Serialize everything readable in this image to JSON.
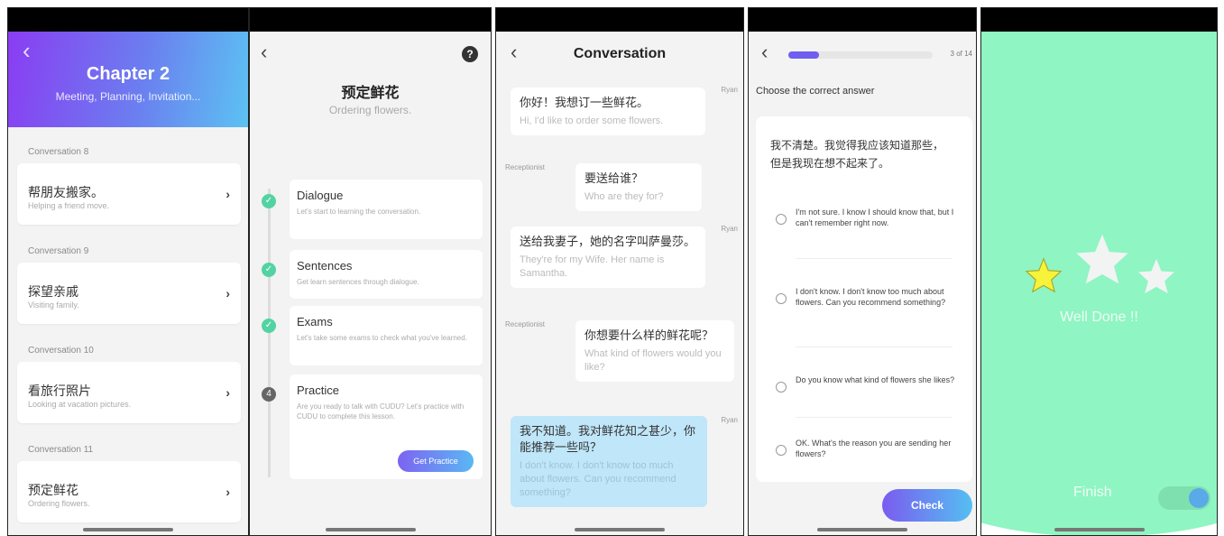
{
  "screen1": {
    "title": "Chapter 2",
    "subtitle": "Meeting, Planning, Invitation...",
    "items": [
      {
        "section": "Conversation 8",
        "zh": "帮朋友搬家。",
        "en": "Helping a friend move."
      },
      {
        "section": "Conversation 9",
        "zh": "探望亲戚",
        "en": "Visiting family."
      },
      {
        "section": "Conversation 10",
        "zh": "看旅行照片",
        "en": "Looking at vacation pictures."
      },
      {
        "section": "Conversation 11",
        "zh": "预定鲜花",
        "en": "Ordering flowers."
      }
    ]
  },
  "screen2": {
    "title_zh": "预定鲜花",
    "title_en": "Ordering flowers.",
    "steps": [
      {
        "title": "Dialogue",
        "desc": "Let's start to learning the conversation.",
        "status": "done"
      },
      {
        "title": "Sentences",
        "desc": "Get learn sentences through dialogue.",
        "status": "done"
      },
      {
        "title": "Exams",
        "desc": "Let's take some exams to check what you've learned.",
        "status": "done"
      },
      {
        "title": "Practice",
        "desc": "Are you ready to talk with CUDU? Let's practice with CUDU to complete this lesson.",
        "status": "4"
      }
    ],
    "practice_button": "Get Practice"
  },
  "screen3": {
    "title": "Conversation",
    "messages": [
      {
        "speaker": "Ryan",
        "zh": "你好！我想订一些鲜花。",
        "en": "Hi, I'd like to order some flowers."
      },
      {
        "speaker": "Receptionist",
        "zh": "要送给谁？",
        "en": "Who are they for?"
      },
      {
        "speaker": "Ryan",
        "zh": "送给我妻子，她的名字叫萨曼莎。",
        "en": "They're for my Wife. Her name is Samantha."
      },
      {
        "speaker": "Receptionist",
        "zh": "你想要什么样的鲜花呢？",
        "en": "What kind of flowers would you like?"
      },
      {
        "speaker": "Ryan",
        "zh": "我不知道。我对鲜花知之甚少，你能推荐一些吗？",
        "en": "I don't know. I don't know too much about flowers. Can you recommend something?"
      }
    ]
  },
  "screen4": {
    "progress_text": "3 of 14",
    "progress_value": 0.2143,
    "prompt": "Choose the correct answer",
    "question": "我不清楚。我觉得我应该知道那些，但是我现在想不起来了。",
    "options": [
      "I'm not sure. I know I should know that, but I can't remember right now.",
      "I don't know. I don't know too much about flowers. Can you recommend something?",
      "Do you know what kind of flowers she likes?",
      "OK. What's the reason you are sending her flowers?"
    ],
    "check_button": "Check"
  },
  "screen5": {
    "message": "Well Done !!",
    "finish": "Finish",
    "stars_earned": 1,
    "stars_total": 3
  },
  "colors": {
    "accent_purple": "#7a5cf0",
    "accent_blue": "#54bff2",
    "success_green": "#53d3a3",
    "finish_bg": "#8ff5c2",
    "star_yellow": "#f7f23a",
    "highlight_bubble": "#bfe6f9"
  }
}
